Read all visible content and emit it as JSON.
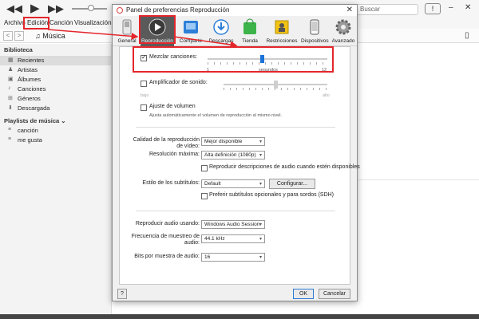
{
  "itunes": {
    "search_placeholder": "Buscar",
    "menu": [
      "Archivo",
      "Edición",
      "Canción",
      "Visualización"
    ],
    "library_selector": "Música",
    "sidebar": {
      "library_header": "Biblioteca",
      "items": [
        {
          "label": "Recientes",
          "icon": "recent-icon"
        },
        {
          "label": "Artistas",
          "icon": "artist-icon"
        },
        {
          "label": "Álbumes",
          "icon": "album-icon"
        },
        {
          "label": "Canciones",
          "icon": "song-icon"
        },
        {
          "label": "Géneros",
          "icon": "genre-icon"
        },
        {
          "label": "Descargada",
          "icon": "download-icon"
        }
      ],
      "playlists_header": "Playlists de música ⌄",
      "playlists": [
        {
          "label": "canción"
        },
        {
          "label": "me gusta"
        }
      ]
    }
  },
  "dialog": {
    "title": "Panel de preferencias Reproducción",
    "tabs": [
      {
        "label": "General",
        "icon": "switch-icon"
      },
      {
        "label": "Reproducción",
        "icon": "play-icon",
        "selected": true
      },
      {
        "label": "Compartir",
        "icon": "share-icon"
      },
      {
        "label": "Descargas",
        "icon": "download-icon"
      },
      {
        "label": "Tienda",
        "icon": "store-bag-icon"
      },
      {
        "label": "Restricciones",
        "icon": "restrictions-icon"
      },
      {
        "label": "Dispositivos",
        "icon": "device-icon"
      },
      {
        "label": "Avanzado",
        "icon": "gear-icon"
      }
    ],
    "crossfade": {
      "label": "Mezclar canciones:",
      "checked": true,
      "min": "1",
      "max": "12",
      "unit": "segundos",
      "value": 6
    },
    "sound_enhancer": {
      "label": "Amplificador de sonido:",
      "checked": false,
      "low": "bajo",
      "high": "alto",
      "value_fraction": 0.5
    },
    "sound_check": {
      "label": "Ajuste de volumen",
      "checked": false,
      "description": "Ajusta automáticamente el volumen de reproducción al mismo nivel."
    },
    "video_quality": {
      "label": "Calidad de la reproducción de vídeo:",
      "value": "Mejor disponible"
    },
    "max_resolution": {
      "label": "Resolución máxima:",
      "value": "Alta definición (1080p)"
    },
    "audio_descriptions": {
      "label": "Reproducir descripciones de audio cuando estén disponibles",
      "checked": false
    },
    "subtitle_style": {
      "label": "Estilo de los subtítulos:",
      "value": "Default",
      "button": "Configurar..."
    },
    "prefer_subtitles": {
      "label": "Preferir subtítulos opcionales y para sordos (SDH)",
      "checked": false
    },
    "audio_output": {
      "label": "Reproducir audio usando:",
      "value": "Windows Audio Session"
    },
    "sample_rate": {
      "label": "Frecuencia de muestreo de audio:",
      "value": "44.1 kHz"
    },
    "bits_per_sample": {
      "label": "Bits por muestra de audio:",
      "value": "16"
    },
    "help": "?",
    "ok": "OK",
    "cancel": "Cancelar"
  },
  "colors": {
    "annotation": "#e3262b",
    "slider_thumb": "#1a73d8"
  }
}
